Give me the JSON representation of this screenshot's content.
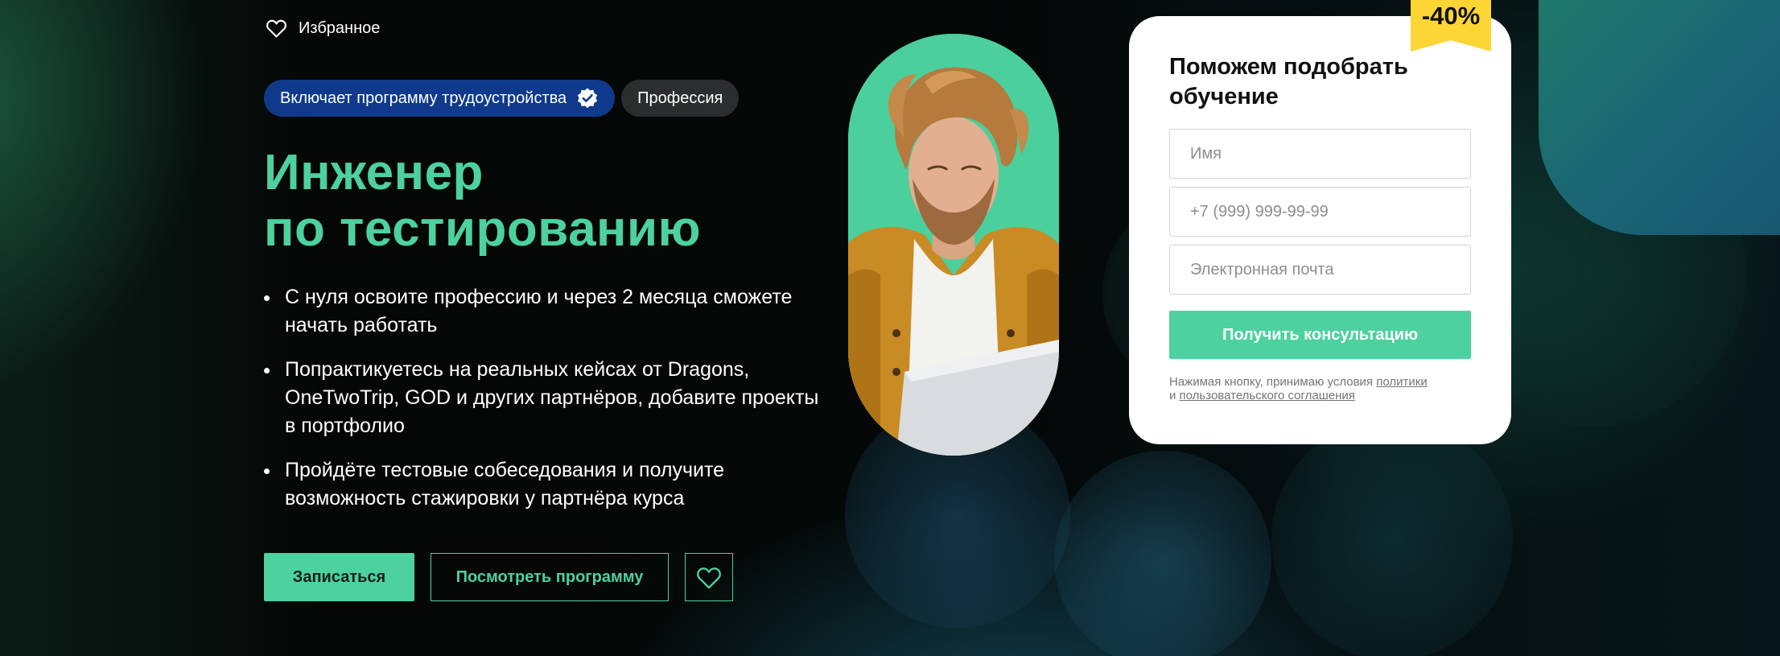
{
  "header": {
    "favorites_label": "Избранное"
  },
  "badges": {
    "employment": "Включает программу трудоустройства",
    "type": "Профессия"
  },
  "title": {
    "line1": "Инженер",
    "line2": "по тестированию"
  },
  "bullets": [
    "С нуля освоите профессию и через 2 месяца сможете начать работать",
    "Попрактикуетесь на реальных кейсах от Dragons, OneTwoTrip, GOD и других партнёров, добавите проекты в портфолио",
    "Пройдёте тестовые собеседования и получите возможность стажировки у партнёра курса"
  ],
  "buttons": {
    "enroll": "Записаться",
    "program": "Посмотреть программу"
  },
  "form": {
    "discount": "-40%",
    "title": "Поможем подобрать обучение",
    "name_placeholder": "Имя",
    "phone_placeholder": "+7 (999) 999-99-99",
    "email_placeholder": "Электронная почта",
    "submit_label": "Получить консультацию",
    "legal_prefix": "Нажимая кнопку, принимаю условия ",
    "policy_link": "политики",
    "legal_and": "и ",
    "agreement_link": "пользовательского соглашения"
  },
  "colors": {
    "accent": "#4cd19f",
    "badge_blue": "#0f3a8c",
    "badge_dark": "#2b2d2e",
    "discount_yellow": "#fdd535"
  },
  "icons": {
    "favorites": "heart-outline-icon",
    "verified": "verified-check-icon",
    "favorite_button": "heart-outline-icon"
  }
}
